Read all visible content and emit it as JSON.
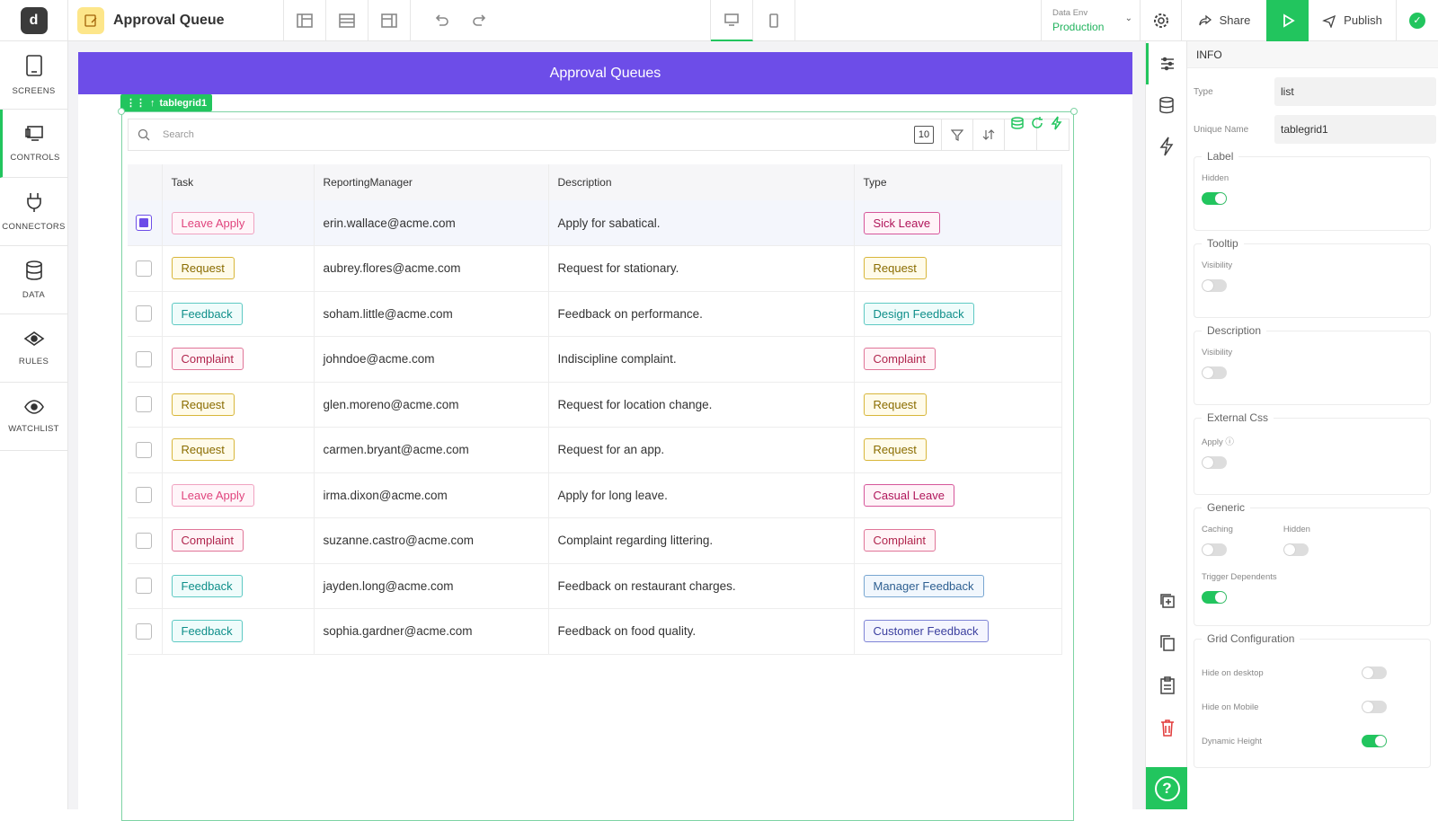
{
  "app": {
    "title": "Approval Queue"
  },
  "topbar": {
    "data_env_label": "Data Env",
    "data_env_value": "Production",
    "share_label": "Share",
    "publish_label": "Publish"
  },
  "leftnav": [
    {
      "label": "SCREENS",
      "icon": "screens-icon"
    },
    {
      "label": "CONTROLS",
      "icon": "controls-icon"
    },
    {
      "label": "CONNECTORS",
      "icon": "plug-icon"
    },
    {
      "label": "DATA",
      "icon": "database-icon"
    },
    {
      "label": "RULES",
      "icon": "rules-icon"
    },
    {
      "label": "WATCHLIST",
      "icon": "eye-icon"
    }
  ],
  "page": {
    "banner_title": "Approval Queues",
    "component_tag": "tablegrid1",
    "search_placeholder": "Search",
    "page_size": "10"
  },
  "table": {
    "headers": [
      "Task",
      "ReportingManager",
      "Description",
      "Type"
    ],
    "rows": [
      {
        "task": "Leave Apply",
        "manager": "erin.wallace@acme.com",
        "desc": "Apply for sabatical.",
        "type": "Sick Leave",
        "selected": true
      },
      {
        "task": "Request",
        "manager": "aubrey.flores@acme.com",
        "desc": "Request for stationary.",
        "type": "Request",
        "selected": false
      },
      {
        "task": "Feedback",
        "manager": "soham.little@acme.com",
        "desc": "Feedback on performance.",
        "type": "Design Feedback",
        "selected": false
      },
      {
        "task": "Complaint",
        "manager": "johndoe@acme.com",
        "desc": "Indiscipline complaint.",
        "type": "Complaint",
        "selected": false
      },
      {
        "task": "Request",
        "manager": "glen.moreno@acme.com",
        "desc": "Request for location change.",
        "type": "Request",
        "selected": false
      },
      {
        "task": "Request",
        "manager": "carmen.bryant@acme.com",
        "desc": "Request for an app.",
        "type": "Request",
        "selected": false
      },
      {
        "task": "Leave Apply",
        "manager": "irma.dixon@acme.com",
        "desc": "Apply for long leave.",
        "type": "Casual Leave",
        "selected": false
      },
      {
        "task": "Complaint",
        "manager": "suzanne.castro@acme.com",
        "desc": "Complaint regarding littering.",
        "type": "Complaint",
        "selected": false
      },
      {
        "task": "Feedback",
        "manager": "jayden.long@acme.com",
        "desc": "Feedback on restaurant charges.",
        "type": "Manager Feedback",
        "selected": false
      },
      {
        "task": "Feedback",
        "manager": "sophia.gardner@acme.com",
        "desc": "Feedback on food quality.",
        "type": "Customer Feedback",
        "selected": false
      }
    ]
  },
  "props": {
    "header": "INFO",
    "type_label": "Type",
    "type_value": "list",
    "unique_name_label": "Unique Name",
    "unique_name_value": "tablegrid1",
    "label_section": "Label",
    "label_hidden": "Hidden",
    "tooltip_section": "Tooltip",
    "tooltip_visibility": "Visibility",
    "description_section": "Description",
    "description_visibility": "Visibility",
    "external_css_section": "External Css",
    "external_css_apply": "Apply",
    "generic_section": "Generic",
    "generic_caching": "Caching",
    "generic_hidden": "Hidden",
    "generic_trigger": "Trigger Dependents",
    "grid_section": "Grid Configuration",
    "grid_hide_desktop": "Hide on desktop",
    "grid_hide_mobile": "Hide on Mobile",
    "grid_dynamic_height": "Dynamic Height"
  },
  "colors": {
    "accent": "#22c55e",
    "banner": "#6d4de8"
  }
}
